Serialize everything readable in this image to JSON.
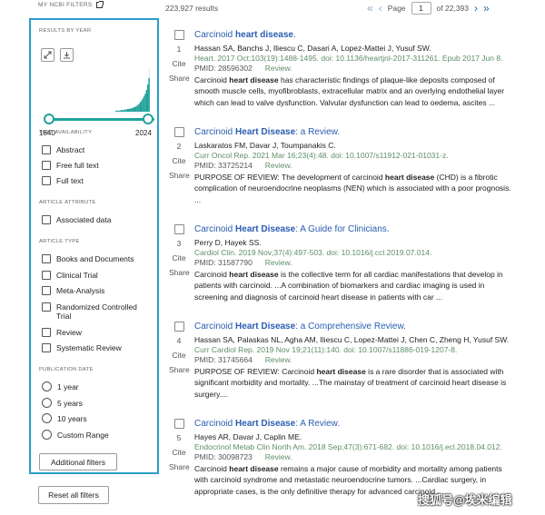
{
  "header": {
    "my_ncbi_filters": "MY NCBI FILTERS",
    "results_count": "223,927 results",
    "page_label": "Page",
    "page_value": "1",
    "page_total": "of 22,393"
  },
  "sidebar": {
    "results_by_year": "RESULTS BY YEAR",
    "year_start": "1840",
    "year_end": "2024",
    "histogram_heights": [
      0.02,
      0.02,
      0.02,
      0.02,
      0.03,
      0.03,
      0.03,
      0.04,
      0.04,
      0.05,
      0.05,
      0.06,
      0.06,
      0.07,
      0.08,
      0.09,
      0.1,
      0.12,
      0.14,
      0.17,
      0.2,
      0.24,
      0.28,
      0.33,
      0.4,
      0.5,
      0.62,
      0.78,
      0.95,
      0.7,
      0.55
    ],
    "text_availability": "TEXT AVAILABILITY",
    "text_options": [
      "Abstract",
      "Free full text",
      "Full text"
    ],
    "article_attribute": "ARTICLE ATTRIBUTE",
    "attribute_options": [
      "Associated data"
    ],
    "article_type": "ARTICLE TYPE",
    "type_options": [
      "Books and Documents",
      "Clinical Trial",
      "Meta-Analysis",
      "Randomized Controlled Trial",
      "Review",
      "Systematic Review"
    ],
    "publication_date": "PUBLICATION DATE",
    "date_options": [
      "1 year",
      "5 years",
      "10 years",
      "Custom Range"
    ],
    "additional_filters": "Additional filters",
    "reset_all": "Reset all filters",
    "accent_color": "#20a29b",
    "border_color": "#2a9fc9"
  },
  "actions": {
    "cite": "Cite",
    "share": "Share"
  },
  "results": [
    {
      "num": "1",
      "title_plain": "Carcinoid ",
      "title_bold": "heart disease",
      "title_rest": ".",
      "authors": "Hassan SA, Banchs J, Iliescu C, Dasari A, Lopez-Mattei J, Yusuf SW.",
      "citation": "Heart. 2017 Oct;103(19):1488-1495. doi: 10.1136/heartjnl-2017-311261. Epub 2017 Jun 8.",
      "pmid": "PMID: 28596302",
      "review": "Review.",
      "snippet": [
        "Carcinoid ",
        "heart disease",
        " has characteristic findings of plaque-like deposits composed of smooth muscle cells, myofibroblasts, extracellular matrix and an overlying endothelial layer which can lead to valve dysfunction. Valvular dysfunction can lead to oedema, ascites ..."
      ]
    },
    {
      "num": "2",
      "title_plain": "Carcinoid ",
      "title_bold": "Heart Disease",
      "title_rest": ": a Review.",
      "authors": "Laskaratos FM, Davar J, Toumpanakis C.",
      "citation": "Curr Oncol Rep. 2021 Mar 16;23(4):48. doi: 10.1007/s11912-021-01031-z.",
      "pmid": "PMID: 33725214",
      "review": "Review.",
      "snippet": [
        "PURPOSE OF REVIEW: The development of carcinoid ",
        "heart disease",
        " (CHD) is a fibrotic complication of neuroendocrine neoplasms (NEN) which is associated with a poor prognosis. ..."
      ]
    },
    {
      "num": "3",
      "title_plain": "Carcinoid ",
      "title_bold": "Heart Disease",
      "title_rest": ": A Guide for Clinicians.",
      "authors": "Perry D, Hayek SS.",
      "citation": "Cardiol Clin. 2019 Nov;37(4):497-503. doi: 10.1016/j.ccl.2019.07.014.",
      "pmid": "PMID: 31587790",
      "review": "Review.",
      "snippet": [
        "Carcinoid ",
        "heart disease",
        " is the collective term for all cardiac manifestations that develop in patients with carcinoid. ...A combination of biomarkers and cardiac imaging is used in screening and diagnosis of carcinoid heart disease in patients with car ..."
      ]
    },
    {
      "num": "4",
      "title_plain": "Carcinoid ",
      "title_bold": "Heart Disease",
      "title_rest": ": a Comprehensive Review.",
      "authors": "Hassan SA, Palaskas NL, Agha AM, Iliescu C, Lopez-Mattei J, Chen C, Zheng H, Yusuf SW.",
      "citation": "Curr Cardiol Rep. 2019 Nov 19;21(11):140. doi: 10.1007/s11886-019-1207-8.",
      "pmid": "PMID: 31745664",
      "review": "Review.",
      "snippet": [
        "PURPOSE OF REVIEW: Carcinoid ",
        "heart disease",
        " is a rare disorder that is associated with significant morbidity and mortality. ...The mainstay of treatment of carcinoid heart disease is surgery...."
      ]
    },
    {
      "num": "5",
      "title_plain": "Carcinoid ",
      "title_bold": "Heart Disease",
      "title_rest": ": A Review.",
      "authors": "Hayes AR, Davar J, Caplin ME.",
      "citation": "Endocrinol Metab Clin North Am. 2018 Sep;47(3):671-682. doi: 10.1016/j.ecl.2018.04.012.",
      "pmid": "PMID: 30098723",
      "review": "Review.",
      "snippet": [
        "Carcinoid ",
        "heart disease",
        " remains a major cause of morbidity and mortality among patients with carcinoid syndrome and metastatic neuroendocrine tumors. ...Cardiac surgery, in appropriate cases, is the only definitive therapy for advanced carcinoid ..."
      ]
    }
  ],
  "watermark": "搜狐号@埃米编辑"
}
